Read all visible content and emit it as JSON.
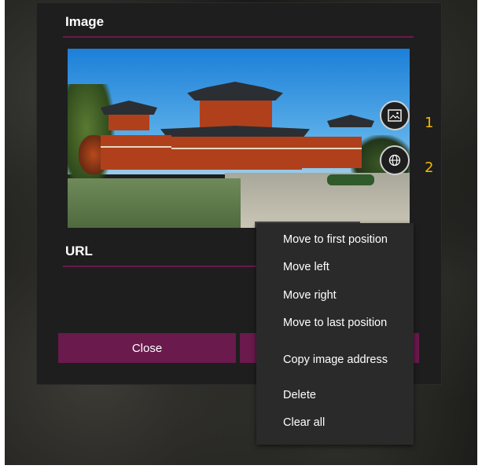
{
  "image_section": {
    "title": "Image"
  },
  "url_section": {
    "title": "URL"
  },
  "buttons": {
    "close_label": "Close",
    "image_annotation": "1",
    "web_annotation": "2"
  },
  "context_menu": {
    "items": [
      "Move to first position",
      "Move left",
      "Move right",
      "Move to last position",
      "Copy image address",
      "Delete",
      "Clear all"
    ]
  },
  "colors": {
    "accent": "#6a1a4c",
    "annotation": "#f5b800",
    "dialog_bg": "#1e1e1e",
    "menu_bg": "#2a2a2a"
  }
}
